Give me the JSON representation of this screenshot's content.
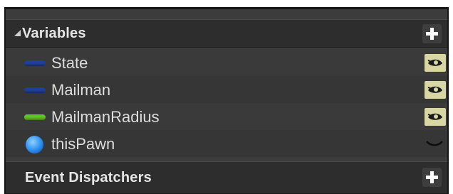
{
  "variables_section": {
    "title": "Variables",
    "add_icon": "plus-icon",
    "items": [
      {
        "name": "State",
        "icon": "pill-icon",
        "color": "#1f3f9a",
        "visibility": "public",
        "visibility_icon": "eye-open-icon"
      },
      {
        "name": "Mailman",
        "icon": "pill-icon",
        "color": "#1f3f9a",
        "visibility": "public",
        "visibility_icon": "eye-open-icon"
      },
      {
        "name": "MailmanRadius",
        "icon": "pill-icon",
        "color": "#63c12c",
        "visibility": "public",
        "visibility_icon": "eye-open-icon"
      },
      {
        "name": "thisPawn",
        "icon": "ball-icon",
        "color": "#2a8cf0",
        "visibility": "private",
        "visibility_icon": "eye-closed-icon"
      }
    ]
  },
  "event_dispatchers_section": {
    "title": "Event Dispatchers",
    "add_icon": "plus-icon"
  },
  "colors": {
    "panel_bg": "#3c3c3c",
    "header_bg": "#2d2d2d",
    "eye_button_bg": "#d8d7a3"
  }
}
